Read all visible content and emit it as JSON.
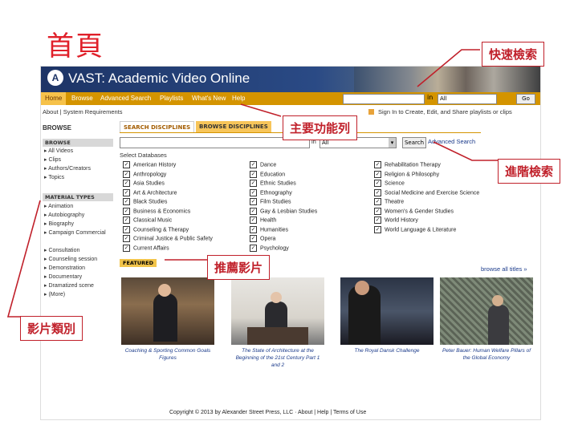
{
  "slide": {
    "title": "首頁",
    "callouts": {
      "quick_search": "快速檢索",
      "main_functions": "主要功能列",
      "advanced_search": "進階檢索",
      "recommended_videos": "推薦影片",
      "video_categories": "影片類別"
    }
  },
  "site": {
    "brand": "VAST: Academic Video Online",
    "logo_glyph": "A",
    "nav": [
      "Home",
      "Browse",
      "Advanced Search",
      "Playlists",
      "What's New",
      "Help"
    ],
    "quick_search": {
      "in_label": "in",
      "select_value": "All",
      "go_label": "Go"
    },
    "account_links": "About | System Requirements",
    "playlist_prompt": "Sign In to Create, Edit, and Share playlists or clips",
    "sidebar": {
      "browse_title": "BROWSE",
      "browse_section": "BROWSE",
      "browse_items": [
        "All Videos",
        "Clips",
        "Authors/Creators",
        "Topics"
      ],
      "material_section": "MATERIAL TYPES",
      "material_items": [
        "Animation",
        "Autobiography",
        "Biography",
        "Campaign Commercial",
        "Consultation",
        "Counseling session",
        "Demonstration",
        "Documentary",
        "Dramatized scene",
        "(More)"
      ]
    },
    "tabs": {
      "search_disciplines": "SEARCH DISCIPLINES",
      "browse_disciplines": "BROWSE DISCIPLINES"
    },
    "discipline_search": {
      "in_label": "in",
      "select_value": "All",
      "search_label": "Search",
      "advanced_link": "Advanced Search"
    },
    "select_databases_label": "Select Databases",
    "disciplines_col1": [
      "American History",
      "Anthropology",
      "Asia Studies",
      "Art & Architecture",
      "Black Studies",
      "Business & Economics",
      "Classical Music",
      "Counseling & Therapy",
      "Criminal Justice & Public Safety",
      "Current Affairs"
    ],
    "disciplines_col2": [
      "Dance",
      "Education",
      "Ethnic Studies",
      "Ethnography",
      "Film Studies",
      "Gay & Lesbian Studies",
      "Health",
      "Humanities",
      "Opera",
      "Psychology"
    ],
    "disciplines_col3": [
      "Rehabilitation Therapy",
      "Religion & Philosophy",
      "Science",
      "Social Medicine and Exercise Science",
      "Theatre",
      "Women's & Gender Studies",
      "World History",
      "World Language & Literature"
    ],
    "featured_label": "FEATURED",
    "browse_all": "browse all titles »",
    "featured_captions": [
      "Coaching & Sporting Common Goals Figures",
      "The State of Architecture at the Beginning of the 21st Century Part 1 and 2",
      "The Royal Dansk Challenge",
      "Peter Bauer: Human Welfare Pillars of the Global Economy"
    ],
    "footer": "Copyright © 2013 by Alexander Street Press, LLC · About | Help | Terms of Use"
  },
  "colors": {
    "accent_red": "#e0202a",
    "nav_orange": "#d49400",
    "banner_blue": "#1d3466",
    "tab_yellow": "#f7c55a"
  }
}
